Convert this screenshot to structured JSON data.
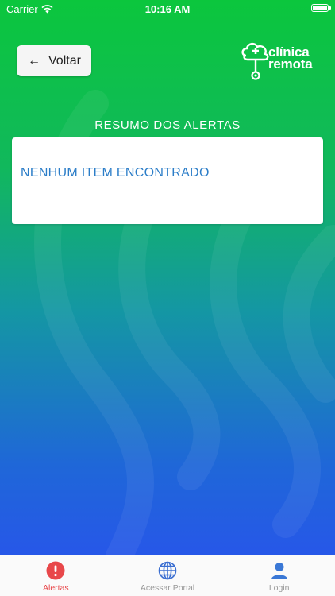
{
  "status_bar": {
    "carrier": "Carrier",
    "time": "10:16 AM"
  },
  "header": {
    "back_label": "Voltar",
    "logo_line1": "clínica",
    "logo_line2": "remota"
  },
  "alerts": {
    "title": "RESUMO DOS ALERTAS",
    "empty_message": "NENHUM ITEM ENCONTRADO"
  },
  "tabs": [
    {
      "label": "Alertas",
      "icon": "alert-icon",
      "active": true
    },
    {
      "label": "Acessar Portal",
      "icon": "globe-icon",
      "active": false
    },
    {
      "label": "Login",
      "icon": "user-icon",
      "active": false
    }
  ],
  "colors": {
    "active_tab": "#e8474a",
    "inactive_tab": "#999999",
    "message_text": "#2b7dc8",
    "gradient_top": "#0bc63d",
    "gradient_bottom": "#2a50f0"
  }
}
